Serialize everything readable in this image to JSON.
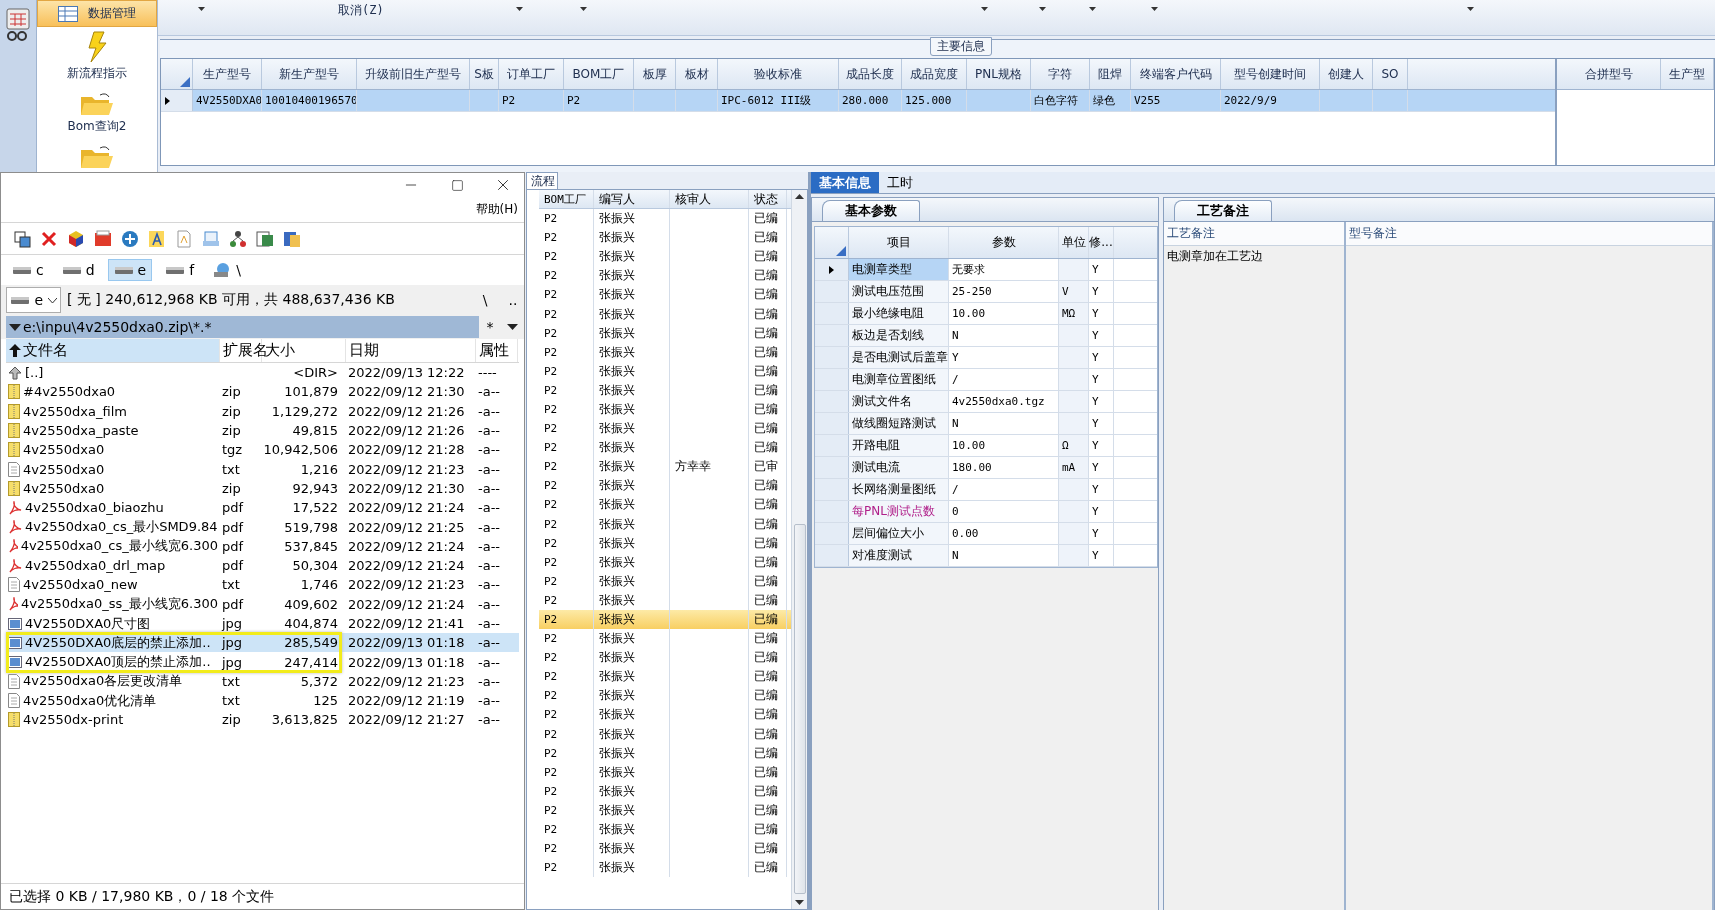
{
  "toolbar": {
    "cancel_label": "取消(Z)"
  },
  "nav": [
    {
      "label": "数据管理",
      "kind": "grid",
      "selected": true
    },
    {
      "label": "新流程指示",
      "kind": "bolt",
      "selected": false
    },
    {
      "label": "Bom查询2",
      "kind": "folder",
      "selected": false
    },
    {
      "kind": "folder",
      "selected": false
    }
  ],
  "main_info": {
    "title": "主要信息",
    "columns": [
      "生产型号",
      "新生产型号",
      "升级前旧生产型号",
      "S板",
      "订单工厂",
      "BOM工厂",
      "板厚",
      "板材",
      "验收标准",
      "成品长度",
      "成品宽度",
      "PNL规格",
      "字符",
      "阻焊",
      "终端客户代码",
      "型号创建时间",
      "创建人",
      "SO"
    ],
    "rows": [
      {
        "selected": true,
        "cells": [
          "4V2550DXA0",
          "10010400196570",
          "",
          "",
          "P2",
          "P2",
          "",
          "",
          "IPC-6012 III级",
          "280.000",
          "125.000",
          "",
          "白色字符",
          "绿色",
          "V255",
          "2022/9/9",
          "",
          ""
        ]
      }
    ],
    "side_columns": [
      "合拼型号",
      "生产型"
    ]
  },
  "flow": {
    "tab": "流程",
    "columns": [
      "BOM工厂",
      "编写人",
      "核审人",
      "状态"
    ],
    "rows": [
      {
        "factory": "P2",
        "writer": "张振兴",
        "status": "已编",
        "selected": false
      },
      {
        "factory": "P2",
        "writer": "张振兴",
        "status": "已编",
        "selected": false
      },
      {
        "factory": "P2",
        "writer": "张振兴",
        "status": "已编",
        "selected": false
      },
      {
        "factory": "P2",
        "writer": "张振兴",
        "status": "已编",
        "selected": false
      },
      {
        "factory": "P2",
        "writer": "张振兴",
        "status": "已编",
        "selected": false
      },
      {
        "factory": "P2",
        "writer": "张振兴",
        "status": "已编",
        "selected": false
      },
      {
        "factory": "P2",
        "writer": "张振兴",
        "status": "已编",
        "selected": false
      },
      {
        "factory": "P2",
        "writer": "张振兴",
        "status": "已编",
        "selected": false
      },
      {
        "factory": "P2",
        "writer": "张振兴",
        "status": "已编",
        "selected": false
      },
      {
        "factory": "P2",
        "writer": "张振兴",
        "status": "已编",
        "selected": false
      },
      {
        "factory": "P2",
        "writer": "张振兴",
        "status": "已编",
        "selected": false
      },
      {
        "factory": "P2",
        "writer": "张振兴",
        "status": "已编",
        "selected": false
      },
      {
        "factory": "P2",
        "writer": "张振兴",
        "status": "已编",
        "selected": false
      },
      {
        "factory": "P2",
        "writer": "张振兴",
        "reviewer": "方幸幸",
        "status": "已审",
        "selected": false
      },
      {
        "factory": "P2",
        "writer": "张振兴",
        "status": "已编",
        "selected": false
      },
      {
        "factory": "P2",
        "writer": "张振兴",
        "status": "已编",
        "selected": false
      },
      {
        "factory": "P2",
        "writer": "张振兴",
        "status": "已编",
        "selected": false
      },
      {
        "factory": "P2",
        "writer": "张振兴",
        "status": "已编",
        "selected": false
      },
      {
        "factory": "P2",
        "writer": "张振兴",
        "status": "已编",
        "selected": false
      },
      {
        "factory": "P2",
        "writer": "张振兴",
        "status": "已编",
        "selected": false
      },
      {
        "factory": "P2",
        "writer": "张振兴",
        "status": "已编",
        "selected": false
      },
      {
        "factory": "P2",
        "writer": "张振兴",
        "status": "已编",
        "selected": true
      },
      {
        "factory": "P2",
        "writer": "张振兴",
        "status": "已编",
        "selected": false
      },
      {
        "factory": "P2",
        "writer": "张振兴",
        "status": "已编",
        "selected": false
      },
      {
        "factory": "P2",
        "writer": "张振兴",
        "status": "已编",
        "selected": false
      },
      {
        "factory": "P2",
        "writer": "张振兴",
        "status": "已编",
        "selected": false
      },
      {
        "factory": "P2",
        "writer": "张振兴",
        "status": "已编",
        "selected": false
      },
      {
        "factory": "P2",
        "writer": "张振兴",
        "status": "已编",
        "selected": false
      },
      {
        "factory": "P2",
        "writer": "张振兴",
        "status": "已编",
        "selected": false
      },
      {
        "factory": "P2",
        "writer": "张振兴",
        "status": "已编",
        "selected": false
      },
      {
        "factory": "P2",
        "writer": "张振兴",
        "status": "已编",
        "selected": false
      },
      {
        "factory": "P2",
        "writer": "张振兴",
        "status": "已编",
        "selected": false
      },
      {
        "factory": "P2",
        "writer": "张振兴",
        "status": "已编",
        "selected": false
      },
      {
        "factory": "P2",
        "writer": "张振兴",
        "status": "已编",
        "selected": false
      },
      {
        "factory": "P2",
        "writer": "张振兴",
        "status": "已编",
        "selected": false
      }
    ]
  },
  "detail": {
    "tabs": [
      {
        "label": "基本信息",
        "selected": true
      },
      {
        "label": "工时",
        "selected": false
      }
    ],
    "params": {
      "tab": "基本参数",
      "columns": [
        "项目",
        "参数",
        "单位",
        "修..."
      ],
      "rows": [
        {
          "item": "电测章类型",
          "value": "无要求",
          "mod": "Y",
          "selected": true,
          "flagged": false
        },
        {
          "item": "测试电压范围",
          "value": "25-250",
          "unit": "V",
          "mod": "Y",
          "selected": false,
          "flagged": false
        },
        {
          "item": "最小绝缘电阻",
          "value": "10.00",
          "unit": "MΩ",
          "mod": "Y",
          "selected": false,
          "flagged": false
        },
        {
          "item": "板边是否划线",
          "value": "N",
          "mod": "Y",
          "selected": false,
          "flagged": false
        },
        {
          "item": "是否电测试后盖章",
          "value": "Y",
          "mod": "Y",
          "selected": false,
          "flagged": false
        },
        {
          "item": "电测章位置图纸",
          "value": "/",
          "mod": "Y",
          "selected": false,
          "flagged": false
        },
        {
          "item": "测试文件名",
          "value": "4v2550dxa0.tgz",
          "mod": "Y",
          "selected": false,
          "flagged": false
        },
        {
          "item": "做线圈短路测试",
          "value": "N",
          "mod": "Y",
          "selected": false,
          "flagged": false
        },
        {
          "item": "开路电阻",
          "value": "10.00",
          "unit": "Ω",
          "mod": "Y",
          "selected": false,
          "flagged": false
        },
        {
          "item": "测试电流",
          "value": "180.00",
          "unit": "mA",
          "mod": "Y",
          "selected": false,
          "flagged": false
        },
        {
          "item": "长网络测量图纸",
          "value": "/",
          "mod": "Y",
          "selected": false,
          "flagged": false
        },
        {
          "item": "每PNL测试点数",
          "value": "0",
          "mod": "Y",
          "selected": false,
          "flagged": true
        },
        {
          "item": "层间偏位大小",
          "value": "0.00",
          "mod": "Y",
          "selected": false,
          "flagged": false
        },
        {
          "item": "对准度测试",
          "value": "N",
          "mod": "Y",
          "selected": false,
          "flagged": false
        }
      ]
    },
    "notes": {
      "tab": "工艺备注",
      "columns": [
        "工艺备注",
        "型号备注"
      ],
      "process_note": "电测章加在工艺边"
    }
  },
  "file_manager": {
    "help_menu": "帮助(H)",
    "drives": [
      {
        "label": "c",
        "selected": false
      },
      {
        "label": "d",
        "selected": false
      },
      {
        "label": "e",
        "selected": true
      },
      {
        "label": "f",
        "selected": false
      },
      {
        "label": "\\",
        "kind": "network",
        "selected": false
      }
    ],
    "drive_select": "e",
    "free_info": "[ 无 ]  240,612,968 KB 可用，共 488,637,436 KB",
    "root_button": "\\",
    "up_button": "..",
    "path": "e:\\inpu\\4v2550dxa0.zip\\*.*",
    "filter": "*",
    "columns": [
      {
        "label": "文件名",
        "sorted": true
      },
      {
        "label": "扩展名",
        "sorted": false
      },
      {
        "label": "大小",
        "sorted": false
      },
      {
        "label": "日期",
        "sorted": false
      },
      {
        "label": "属性",
        "sorted": false
      }
    ],
    "files": [
      {
        "kind": "up",
        "name": "[..]",
        "size": "<DIR>",
        "date": "2022/09/13 12:22",
        "attr": "----",
        "selected": false
      },
      {
        "kind": "zip",
        "name": "#4v2550dxa0",
        "ext": "zip",
        "size": "101,879",
        "date": "2022/09/12 21:30",
        "attr": "-a--",
        "selected": false
      },
      {
        "kind": "zip",
        "name": "4v2550dxa_film",
        "ext": "zip",
        "size": "1,129,272",
        "date": "2022/09/12 21:26",
        "attr": "-a--",
        "selected": false
      },
      {
        "kind": "zip",
        "name": "4v2550dxa_paste",
        "ext": "zip",
        "size": "49,815",
        "date": "2022/09/12 21:26",
        "attr": "-a--",
        "selected": false
      },
      {
        "kind": "zip",
        "name": "4v2550dxa0",
        "ext": "tgz",
        "size": "10,942,506",
        "date": "2022/09/12 21:28",
        "attr": "-a--",
        "selected": false
      },
      {
        "kind": "txt",
        "name": "4v2550dxa0",
        "ext": "txt",
        "size": "1,216",
        "date": "2022/09/12 21:23",
        "attr": "-a--",
        "selected": false
      },
      {
        "kind": "zip",
        "name": "4v2550dxa0",
        "ext": "zip",
        "size": "92,943",
        "date": "2022/09/12 21:30",
        "attr": "-a--",
        "selected": false
      },
      {
        "kind": "pdf",
        "name": "4v2550dxa0_biaozhu",
        "ext": "pdf",
        "size": "17,522",
        "date": "2022/09/12 21:24",
        "attr": "-a--",
        "selected": false
      },
      {
        "kind": "pdf",
        "name": "4v2550dxa0_cs_最小SMD9.84",
        "ext": "pdf",
        "size": "519,798",
        "date": "2022/09/12 21:25",
        "attr": "-a--",
        "selected": false
      },
      {
        "kind": "pdf",
        "name": "4v2550dxa0_cs_最小线宽6.300",
        "ext": "pdf",
        "size": "537,845",
        "date": "2022/09/12 21:24",
        "attr": "-a--",
        "selected": false
      },
      {
        "kind": "pdf",
        "name": "4v2550dxa0_drl_map",
        "ext": "pdf",
        "size": "50,304",
        "date": "2022/09/12 21:24",
        "attr": "-a--",
        "selected": false
      },
      {
        "kind": "txt",
        "name": "4v2550dxa0_new",
        "ext": "txt",
        "size": "1,746",
        "date": "2022/09/12 21:23",
        "attr": "-a--",
        "selected": false
      },
      {
        "kind": "pdf",
        "name": "4v2550dxa0_ss_最小线宽6.300",
        "ext": "pdf",
        "size": "409,602",
        "date": "2022/09/12 21:24",
        "attr": "-a--",
        "selected": false
      },
      {
        "kind": "jpg",
        "name": "4V2550DXA0尺寸图",
        "ext": "jpg",
        "size": "404,874",
        "date": "2022/09/12 21:41",
        "attr": "-a--",
        "selected": false
      },
      {
        "kind": "jpg",
        "name": "4V2550DXA0底层的禁止添加..",
        "ext": "jpg",
        "size": "285,549",
        "date": "2022/09/13 01:18",
        "attr": "-a--",
        "selected": true
      },
      {
        "kind": "jpg",
        "name": "4V2550DXA0顶层的禁止添加..",
        "ext": "jpg",
        "size": "247,414",
        "date": "2022/09/13 01:18",
        "attr": "-a--",
        "selected": false
      },
      {
        "kind": "txt",
        "name": "4v2550dxa0各层更改清单",
        "ext": "txt",
        "size": "5,372",
        "date": "2022/09/12 21:23",
        "attr": "-a--",
        "selected": false
      },
      {
        "kind": "txt",
        "name": "4v2550dxa0优化清单",
        "ext": "txt",
        "size": "125",
        "date": "2022/09/12 21:19",
        "attr": "-a--",
        "selected": false
      },
      {
        "kind": "zip",
        "name": "4v2550dx-print",
        "ext": "zip",
        "size": "3,613,825",
        "date": "2022/09/12 21:27",
        "attr": "-a--",
        "selected": false
      }
    ],
    "status": "已选择 0 KB / 17,980 KB，0 / 18 个文件"
  }
}
